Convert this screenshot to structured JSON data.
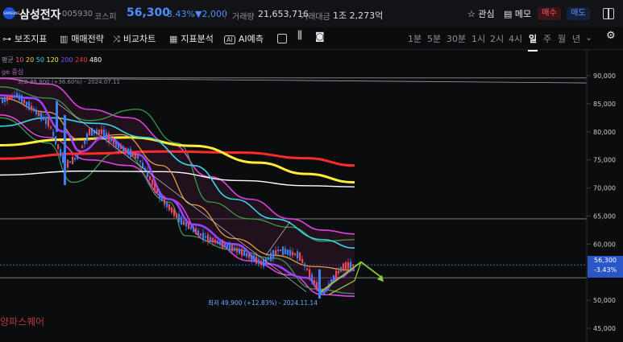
{
  "ticker": {
    "logo_text": "SAMSUNG",
    "name": "삼성전자",
    "code": "005930",
    "market": "코스피",
    "price": "56,300",
    "change_pct": "-3.43%",
    "change": "▼2,000",
    "volume_label": "거래량",
    "volume": "21,653,716",
    "amount_label": "거래대금",
    "amount": "1조 2,273억"
  },
  "actions": {
    "favorite": "관심",
    "memo": "메모",
    "buy": "매수",
    "sell": "매도"
  },
  "toolbar": {
    "tools": [
      {
        "icon": "indicator-icon",
        "label": "보조지표"
      },
      {
        "icon": "strategy-icon",
        "label": "매매전략"
      },
      {
        "icon": "compare-icon",
        "label": "비교차트"
      },
      {
        "icon": "analysis-icon",
        "label": "지표분석"
      },
      {
        "icon": "ai-icon",
        "label": "AI예측"
      }
    ],
    "periods": [
      "1분",
      "5분",
      "30분",
      "1시",
      "2시",
      "4시",
      "일",
      "주",
      "월",
      "년"
    ],
    "active_period": "일"
  },
  "legend": {
    "ma_label": "평균",
    "ma_periods": [
      {
        "label": "10",
        "color": "#ff4d8d"
      },
      {
        "label": "20",
        "color": "#ffcc33"
      },
      {
        "label": "50",
        "color": "#33d6e6"
      },
      {
        "label": "120",
        "color": "#ffee33"
      },
      {
        "label": "200",
        "color": "#8855ff"
      },
      {
        "label": "240",
        "color": "#ff3333"
      },
      {
        "label": "480",
        "color": "#ffffff"
      }
    ],
    "envelope_label": "ge 중심",
    "high_annotation": "최고 88,800 (+36.60%) - 2024.07.11",
    "low_annotation": "최저 49,900 (+12.83%) - 2024.11.14"
  },
  "watermark": "양파스퀘어",
  "chart_data": {
    "type": "candlestick",
    "y_axis_ticks": [
      "90,000",
      "85,000",
      "80,000",
      "75,000",
      "70,000",
      "65,000",
      "60,000",
      "55,000",
      "50,000",
      "45,000"
    ],
    "ylim": [
      45000,
      92500
    ],
    "last_price": "56,300",
    "last_change_pct": "-3.43%",
    "high": 88800,
    "low": 49900,
    "horizontal_levels": [
      89600,
      64500,
      54000
    ],
    "colors": {
      "up": "#e84a5a",
      "down": "#3f7ff0"
    }
  }
}
